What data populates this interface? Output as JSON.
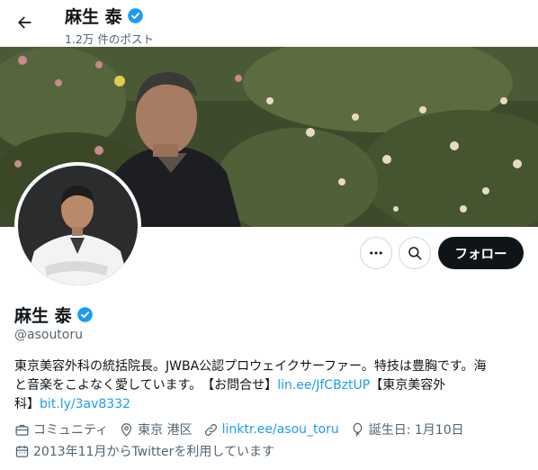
{
  "header": {
    "name": "麻生 泰",
    "post_count": "1.2万 件のポスト"
  },
  "profile": {
    "name": "麻生 泰",
    "handle": "@asoutoru",
    "follow_label": "フォロー",
    "bio": {
      "line1": "東京美容外科の統括院長。JWBA公認プロウェイクサーファー。特技は豊胸です。海",
      "line2_text": "と音楽をこよなく愛しています。　【お問合せ】",
      "line2_link": "lin.ee/JfCBztUP",
      "line2_tail": "【東京美容外",
      "line3_text": "科】",
      "line3_link": "bit.ly/3av8332"
    },
    "meta": {
      "category": "コミュニティ",
      "location": "東京 港区",
      "website": "linktr.ee/asou_toru",
      "birthday": "誕生日: 1月10日",
      "joined": "2013年11月からTwitterを利用しています"
    }
  },
  "colors": {
    "verified": "#1d9bf0",
    "link": "#1d9bf0",
    "secondary_text": "#536471",
    "follow_button_bg": "#0f1419"
  },
  "icons": [
    "back-arrow-icon",
    "verified-badge-icon",
    "more-icon",
    "search-icon",
    "briefcase-icon",
    "location-pin-icon",
    "link-icon",
    "balloon-icon",
    "calendar-icon"
  ]
}
